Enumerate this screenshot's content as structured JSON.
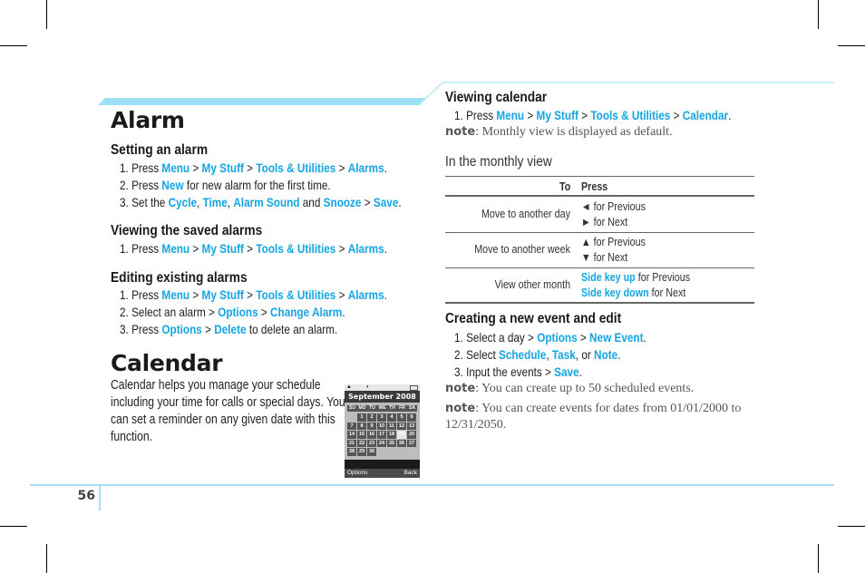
{
  "page_number": "56",
  "colors": {
    "accent": "#14a5e3",
    "band": "#9ee0f5",
    "text": "#1e1e1e",
    "note": "#555555"
  },
  "left": {
    "alarm": {
      "title": "Alarm",
      "setting": {
        "heading": "Setting an alarm",
        "steps": [
          {
            "n": "1. Press ",
            "parts": [
              [
                "Menu",
                true
              ],
              [
                " > ",
                false
              ],
              [
                "My Stuff",
                true
              ],
              [
                " > ",
                false
              ],
              [
                "Tools & Utilities",
                true
              ],
              [
                " > ",
                false
              ],
              [
                "Alarms",
                true
              ],
              [
                ".",
                false
              ]
            ]
          },
          {
            "n": "2. Press ",
            "parts": [
              [
                "New",
                true
              ],
              [
                " for new alarm for the first time.",
                false
              ]
            ]
          },
          {
            "n": "3. Set the ",
            "parts": [
              [
                "Cycle",
                true
              ],
              [
                ", ",
                false
              ],
              [
                "Time",
                true
              ],
              [
                ", ",
                false
              ],
              [
                "Alarm Sound",
                true
              ],
              [
                " and ",
                false
              ],
              [
                "Snooze",
                true
              ],
              [
                " > ",
                false
              ],
              [
                "Save",
                true
              ],
              [
                ".",
                false
              ]
            ]
          }
        ]
      },
      "viewing": {
        "heading": "Viewing the saved alarms",
        "steps": [
          {
            "n": "1. Press ",
            "parts": [
              [
                "Menu",
                true
              ],
              [
                " > ",
                false
              ],
              [
                "My Stuff",
                true
              ],
              [
                " > ",
                false
              ],
              [
                "Tools & Utilities",
                true
              ],
              [
                " > ",
                false
              ],
              [
                "Alarms",
                true
              ],
              [
                ".",
                false
              ]
            ]
          }
        ]
      },
      "editing": {
        "heading": "Editing existing alarms",
        "steps": [
          {
            "n": "1. Press ",
            "parts": [
              [
                "Menu",
                true
              ],
              [
                " > ",
                false
              ],
              [
                "My Stuff",
                true
              ],
              [
                " > ",
                false
              ],
              [
                "Tools & Utilities",
                true
              ],
              [
                " > ",
                false
              ],
              [
                "Alarms",
                true
              ],
              [
                ".",
                false
              ]
            ]
          },
          {
            "n": "2. Select an alarm > ",
            "parts": [
              [
                "Options",
                true
              ],
              [
                " > ",
                false
              ],
              [
                "Change Alarm",
                true
              ],
              [
                ".",
                false
              ]
            ]
          },
          {
            "n": "3. Press ",
            "parts": [
              [
                "Options",
                true
              ],
              [
                " > ",
                false
              ],
              [
                "Delete",
                true
              ],
              [
                " to delete an alarm.",
                false
              ]
            ]
          }
        ]
      }
    },
    "calendar": {
      "title": "Calendar",
      "intro": "Calendar helps you manage your schedule including your time for calls or special days. You can set a reminder on any given date with this function."
    },
    "phone_screen": {
      "month_title": "September 2008",
      "weekdays": [
        "SU",
        "MO",
        "TU",
        "WE",
        "TH",
        "FR",
        "SA"
      ],
      "leading_blanks": 1,
      "days": 30,
      "selected_day": 19,
      "softkey_left": "Options",
      "softkey_right": "Back"
    }
  },
  "right": {
    "viewing_calendar": {
      "heading": "Viewing calendar",
      "steps": [
        {
          "n": "1. Press ",
          "parts": [
            [
              "Menu",
              true
            ],
            [
              " > ",
              false
            ],
            [
              "My Stuff",
              true
            ],
            [
              " > ",
              false
            ],
            [
              "Tools & Utilities",
              true
            ],
            [
              " > ",
              false
            ],
            [
              "Calendar",
              true
            ],
            [
              ".",
              false
            ]
          ]
        }
      ],
      "note_label": "note",
      "note": ": Monthly view is displayed as default."
    },
    "monthly_view": {
      "heading": "In the monthly view",
      "table": {
        "headers": [
          "To",
          "Press"
        ],
        "rows": [
          {
            "to": "Move to another day",
            "press": [
              [
                [
                  "◄",
                  false
                ],
                [
                  " for Previous",
                  false
                ]
              ],
              [
                [
                  "►",
                  false
                ],
                [
                  " for Next",
                  false
                ]
              ]
            ]
          },
          {
            "to": "Move to another week",
            "press": [
              [
                [
                  "▲",
                  false
                ],
                [
                  " for Previous",
                  false
                ]
              ],
              [
                [
                  "▼",
                  false
                ],
                [
                  " for Next",
                  false
                ]
              ]
            ]
          },
          {
            "to": "View other month",
            "press": [
              [
                [
                  "Side key up",
                  true
                ],
                [
                  " for Previous",
                  false
                ]
              ],
              [
                [
                  "Side key down",
                  true
                ],
                [
                  " for Next",
                  false
                ]
              ]
            ]
          }
        ]
      }
    },
    "creating": {
      "heading": "Creating a new event and edit",
      "steps": [
        {
          "n": "1. Select a day > ",
          "parts": [
            [
              "Options",
              true
            ],
            [
              " > ",
              false
            ],
            [
              "New Event",
              true
            ],
            [
              ".",
              false
            ]
          ]
        },
        {
          "n": "2. Select ",
          "parts": [
            [
              "Schedule",
              true
            ],
            [
              ", ",
              false
            ],
            [
              "Task",
              true
            ],
            [
              ", or ",
              false
            ],
            [
              "Note",
              true
            ],
            [
              ".",
              false
            ]
          ]
        },
        {
          "n": "3. Input the events > ",
          "parts": [
            [
              "Save",
              true
            ],
            [
              ".",
              false
            ]
          ]
        }
      ],
      "notes": [
        {
          "label": "note",
          "text": ": You can create up to 50 scheduled events."
        },
        {
          "label": "note",
          "text": ": You can create events for dates from 01/01/2000 to 12/31/2050."
        }
      ]
    }
  }
}
